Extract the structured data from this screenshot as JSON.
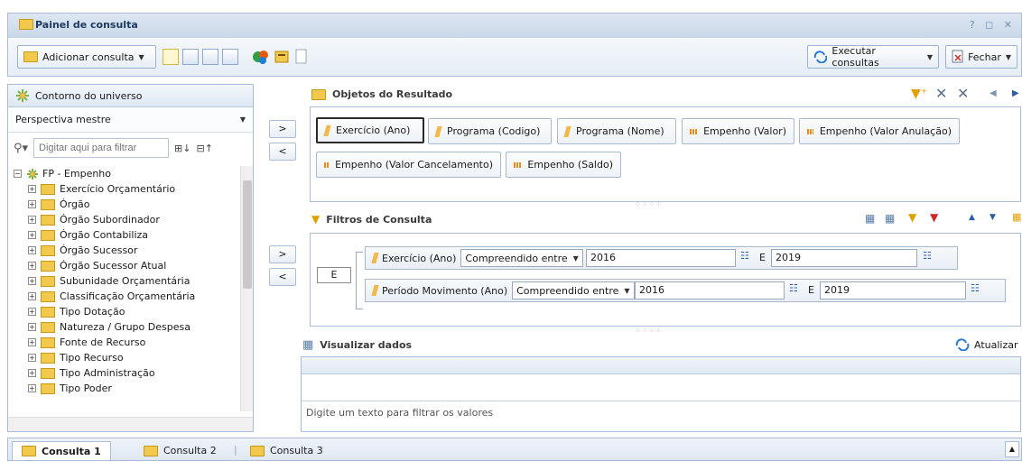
{
  "window": {
    "title": "Painel de consulta",
    "controls": "? ◻ ✕"
  },
  "toolbar": {
    "add_query": "Adicionar consulta",
    "run_queries": "Executar consultas",
    "close": "Fechar"
  },
  "universe": {
    "title": "Contorno do universo",
    "perspective": "Perspectiva mestre",
    "filter_placeholder": "Digitar aqui para filtrar",
    "root": "FP - Empenho",
    "items": [
      "Exercício Orçamentário",
      "Órgão",
      "Órgão Subordinador",
      "Órgão Contabiliza",
      "Órgão Sucessor",
      "Órgão Sucessor Atual",
      "Subunidade Orçamentária",
      "Classificação Orçamentária",
      "Tipo Dotação",
      "Natureza / Grupo Despesa",
      "Fonte de Recurso",
      "Tipo Recurso",
      "Tipo Administração",
      "Tipo Poder"
    ]
  },
  "result_objects": {
    "title": "Objetos do Resultado",
    "chips": [
      {
        "label": "Exercício (Ano)",
        "kind": "dimension"
      },
      {
        "label": "Programa (Codigo)",
        "kind": "dimension"
      },
      {
        "label": "Programa (Nome)",
        "kind": "dimension"
      },
      {
        "label": "Empenho (Valor)",
        "kind": "measure"
      },
      {
        "label": "Empenho (Valor Anulação)",
        "kind": "measure"
      },
      {
        "label": "Empenho (Valor Cancelamento)",
        "kind": "measure"
      },
      {
        "label": "Empenho (Saldo)",
        "kind": "measure"
      }
    ]
  },
  "query_filters": {
    "title": "Filtros de Consulta",
    "operator": "E",
    "rows": [
      {
        "object": "Exercício (Ano)",
        "condition": "Compreendido entre",
        "from": "2016",
        "and": "E",
        "to": "2019"
      },
      {
        "object": "Período Movimento (Ano)",
        "condition": "Compreendido entre",
        "from": "2016",
        "and": "E",
        "to": "2019"
      }
    ]
  },
  "data_preview": {
    "title": "Visualizar dados",
    "refresh": "Atualizar",
    "filter_placeholder": "Digite um texto para filtrar os valores"
  },
  "tabs": [
    "Consulta 1",
    "Consulta 2",
    "Consulta 3"
  ],
  "arrows": {
    "add": ">",
    "remove": "<"
  }
}
